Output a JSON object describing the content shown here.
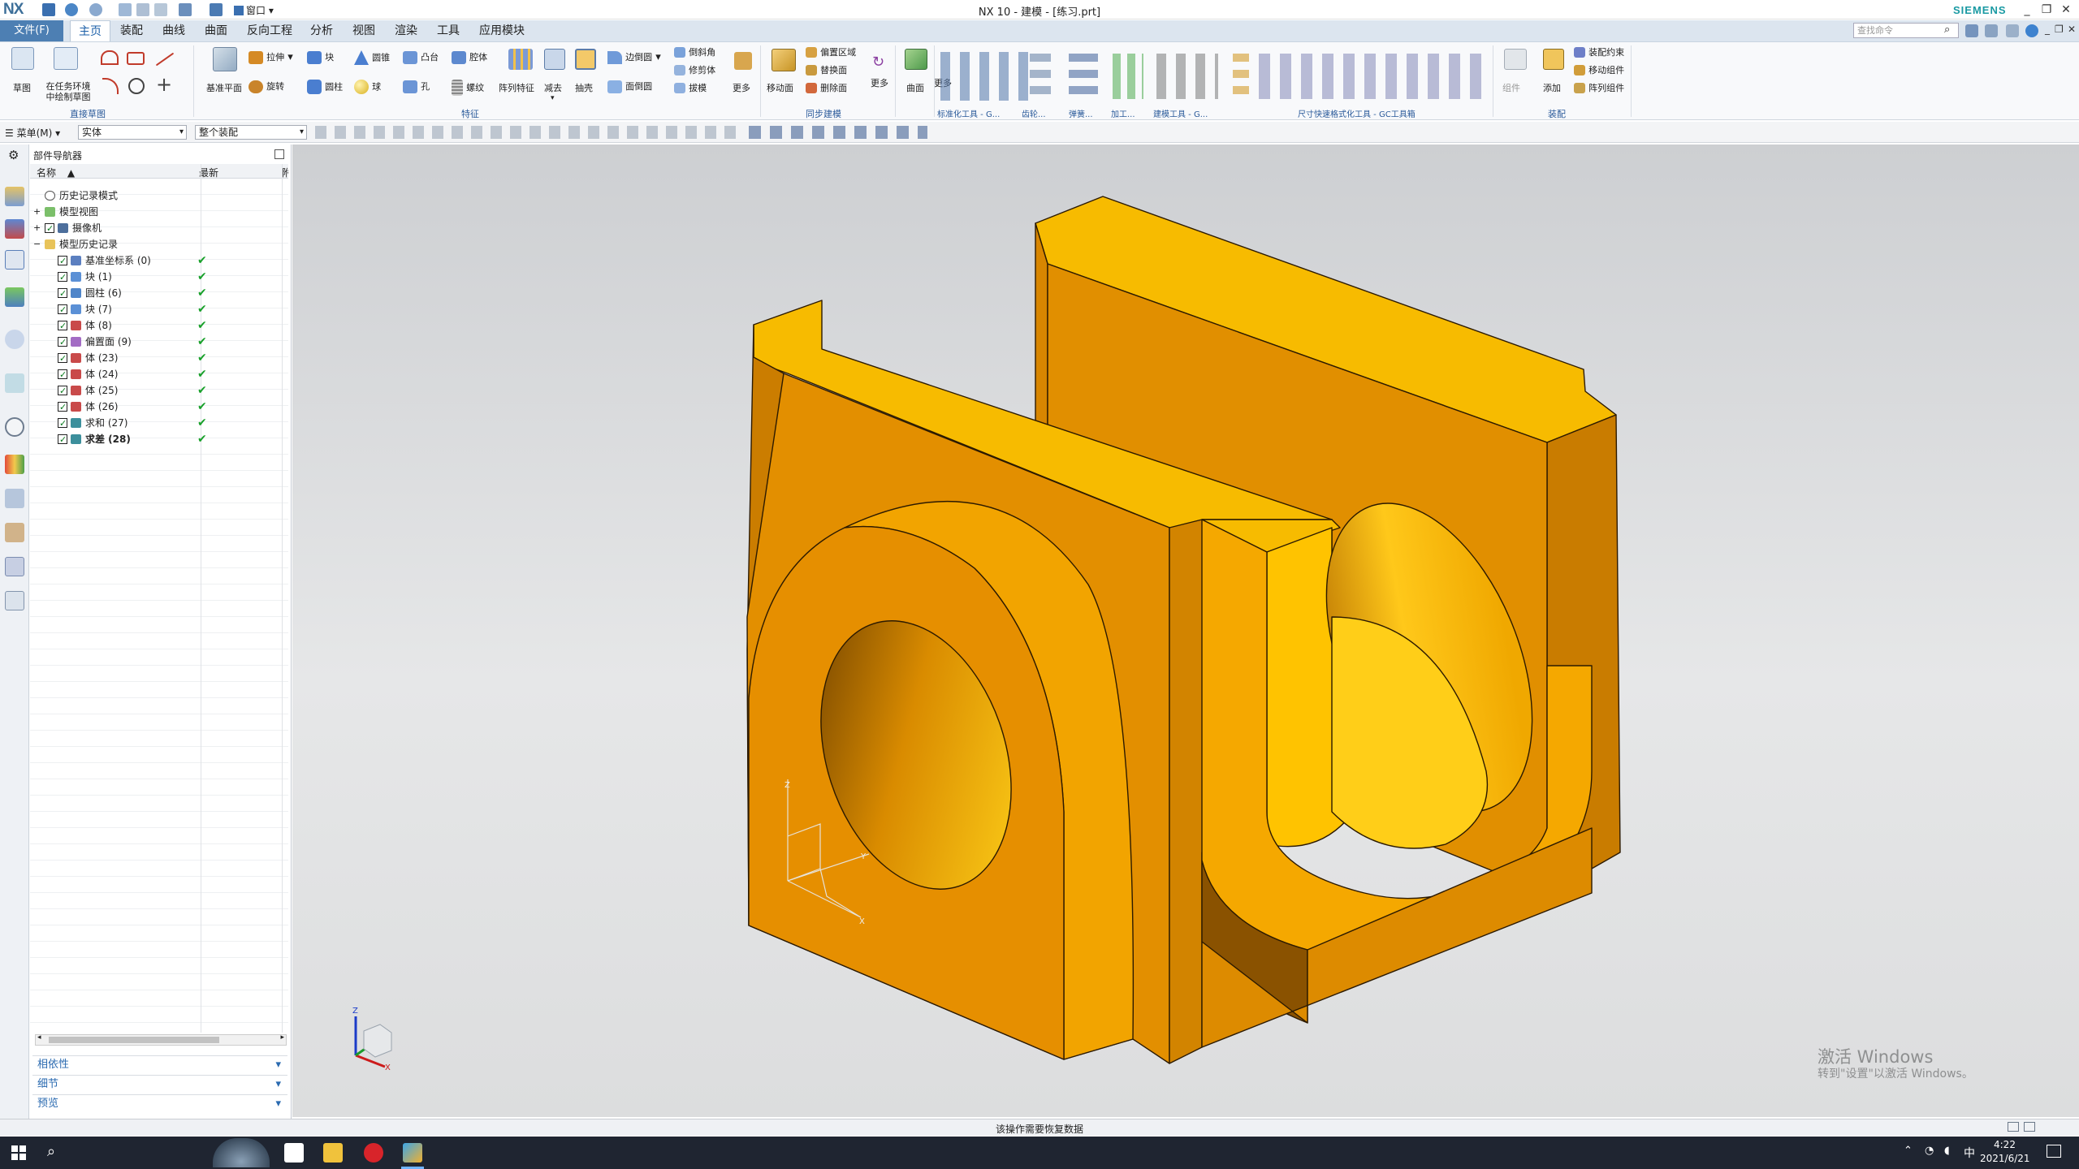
{
  "app": {
    "logo": "NX",
    "title": "NX 10 - 建模 - [练习.prt]",
    "brand": "SIEMENS",
    "window_menu": "窗口"
  },
  "menubar": {
    "file": "文件(F)",
    "tabs": [
      "主页",
      "装配",
      "曲线",
      "曲面",
      "反向工程",
      "分析",
      "视图",
      "渲染",
      "工具",
      "应用模块"
    ],
    "active_tab": "主页",
    "search_placeholder": "查找命令"
  },
  "ribbon": {
    "sketch_group": {
      "buttons": [
        "草图",
        "在任务环境中绘制草图"
      ],
      "label": "直接草图"
    },
    "feature_group": {
      "large": [
        "基准平面",
        "阵列特征",
        "减去",
        "抽壳"
      ],
      "small": [
        "拉伸",
        "块",
        "圆锥",
        "凸台",
        "腔体",
        "旋转",
        "圆柱",
        "球",
        "孔",
        "螺纹",
        "边倒圆",
        "倒斜角",
        "修剪体",
        "拔模",
        "面倒圆"
      ],
      "more": "更多",
      "label": "特征"
    },
    "sync_group": {
      "large": [
        "移动面"
      ],
      "small": [
        "偏置区域",
        "替换面",
        "删除面"
      ],
      "more": "更多",
      "label": "同步建模"
    },
    "surface_group": {
      "large": [
        "曲面"
      ],
      "more": "更多"
    },
    "toolbar_labels": [
      "标准化工具 - G...",
      "齿轮...",
      "弹簧...",
      "加工...",
      "建模工具 - G...",
      "尺寸快速格式化工具 - GC工具箱"
    ],
    "assembly_group": {
      "large": [
        "组件",
        "添加"
      ],
      "small": [
        "装配约束",
        "移动组件",
        "阵列组件"
      ],
      "label": "装配"
    }
  },
  "selbar": {
    "menu": "菜单(M)",
    "filter": "实体",
    "scope": "整个装配"
  },
  "navigator": {
    "title": "部件导航器",
    "col_name": "名称",
    "col_latest": "最新",
    "col_extra": "附",
    "rows": [
      {
        "label": "历史记录模式",
        "indent": 0
      },
      {
        "label": "模型视图",
        "indent": 0
      },
      {
        "label": "摄像机",
        "indent": 0
      },
      {
        "label": "模型历史记录",
        "indent": 0
      },
      {
        "label": "基准坐标系 (0)",
        "indent": 1,
        "ok": true
      },
      {
        "label": "块 (1)",
        "indent": 1,
        "ok": true
      },
      {
        "label": "圆柱 (6)",
        "indent": 1,
        "ok": true
      },
      {
        "label": "块 (7)",
        "indent": 1,
        "ok": true
      },
      {
        "label": "体 (8)",
        "indent": 1,
        "ok": true
      },
      {
        "label": "偏置面 (9)",
        "indent": 1,
        "ok": true
      },
      {
        "label": "体 (23)",
        "indent": 1,
        "ok": true
      },
      {
        "label": "体 (24)",
        "indent": 1,
        "ok": true
      },
      {
        "label": "体 (25)",
        "indent": 1,
        "ok": true
      },
      {
        "label": "体 (26)",
        "indent": 1,
        "ok": true
      },
      {
        "label": "求和 (27)",
        "indent": 1,
        "ok": true
      },
      {
        "label": "求差 (28)",
        "indent": 1,
        "ok": true,
        "bold": true
      }
    ],
    "panels": [
      "相依性",
      "细节",
      "预览"
    ]
  },
  "viewport": {
    "axis_z": "Z",
    "axis_x": "X",
    "axis_y": "Y"
  },
  "status": {
    "message": "该操作需要恢复数据"
  },
  "watermark": {
    "line1": "激活 Windows",
    "line2": "转到\"设置\"以激活 Windows。"
  },
  "taskbar": {
    "time": "4:22",
    "date": "2021/6/21",
    "ime": "中"
  },
  "colors": {
    "part_face": "#f5b400",
    "part_side": "#e28d00",
    "accent_blue": "#1b5fa8"
  }
}
